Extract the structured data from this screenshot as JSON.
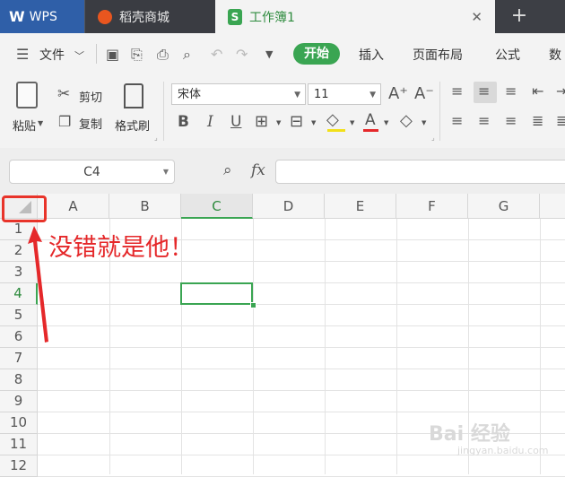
{
  "tabs": {
    "wps": "WPS",
    "daoke": "稻壳商城",
    "workbook": "工作簿1",
    "close": "✕",
    "new": "+"
  },
  "menu": {
    "file": "文件",
    "start": "开始",
    "insert": "插入",
    "page_layout": "页面布局",
    "formula": "公式",
    "data": "数"
  },
  "ribbon": {
    "paste": "粘贴",
    "cut": "剪切",
    "copy": "复制",
    "format_painter": "格式刷",
    "font_name": "宋体",
    "font_size": "11",
    "bold": "B",
    "italic": "I",
    "underline": "U",
    "font_color_letter": "A"
  },
  "formula_bar": {
    "name_box": "C4",
    "fx": "fx"
  },
  "grid": {
    "columns": [
      "A",
      "B",
      "C",
      "D",
      "E",
      "F",
      "G"
    ],
    "selected_column": "C",
    "rows": [
      "1",
      "2",
      "3",
      "4",
      "5",
      "6",
      "7",
      "8",
      "9",
      "10",
      "11",
      "12"
    ],
    "selected_row": "4"
  },
  "annotation": {
    "text": "没错就是他！"
  },
  "watermark": {
    "text": "Bai 经验",
    "url": "jingyan.baidu.com"
  },
  "colors": {
    "accent": "#3aa552",
    "titlebar": "#3d3f45",
    "wps_tab": "#2f5fa8",
    "annotation": "#e5282a"
  }
}
